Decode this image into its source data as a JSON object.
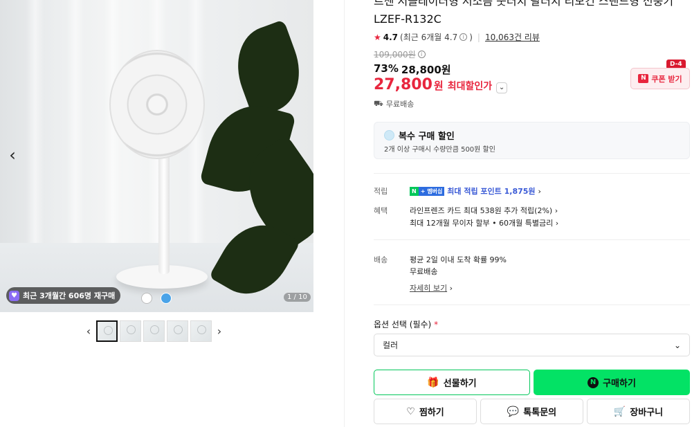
{
  "gallery": {
    "rebuy_badge": "최근 3개월간 606명 재구매",
    "counter": "1 / 10",
    "prev": "‹",
    "next": "›"
  },
  "thumbnails": {
    "prev": "‹",
    "next": "›",
    "count": 5
  },
  "product": {
    "title_line1": "르젠 저클레이터형 저소음 풋터치 팔터치 리모컨 스탠드형 선풍기",
    "title_line2": "LZEF-R132C",
    "rating": "4.7",
    "rating_recent": "(최근 6개월 4.7",
    "rating_recent_close": ")",
    "review_count": "10,063건 리뷰",
    "original_price": "109,000원",
    "discount_rate": "73%",
    "sale_price": "28,800원",
    "max_price": "27,800",
    "max_won": "원",
    "max_label": "최대할인가",
    "free_shipping": "무료배송"
  },
  "coupon": {
    "label": "쿠폰 받기",
    "n": "N",
    "dday": "D-4"
  },
  "multi_discount": {
    "title": "복수 구매 할인",
    "desc": "2개 이상 구매시 수량만큼 500원 할인"
  },
  "benefits": {
    "point_label": "적립",
    "np_n": "N",
    "np_plus": "+ 멤버십",
    "point_text": "최대 적립 포인트 1,875원",
    "benefit_label": "혜택",
    "benefit_1": "라인프렌즈 카드 최대 538원 추가 적립(2%)",
    "benefit_2": "최대 12개월 무이자 할부 • 60개월 특별금리"
  },
  "delivery": {
    "label": "배송",
    "line1": "평균 2일 이내 도착 확률 99%",
    "line2": "무료배송",
    "detail": "자세히 보기"
  },
  "options": {
    "label": "옵션 선택 (필수)",
    "req": "*",
    "select_value": "컬러"
  },
  "actions": {
    "gift": "선물하기",
    "buy": "구매하기",
    "buy_n": "N",
    "wish": "찜하기",
    "talk": "톡톡문의",
    "cart": "장바구니"
  },
  "colors": {
    "accent_red": "#e8263e",
    "naver_green": "#03c75a",
    "buy_green": "#03e265"
  }
}
